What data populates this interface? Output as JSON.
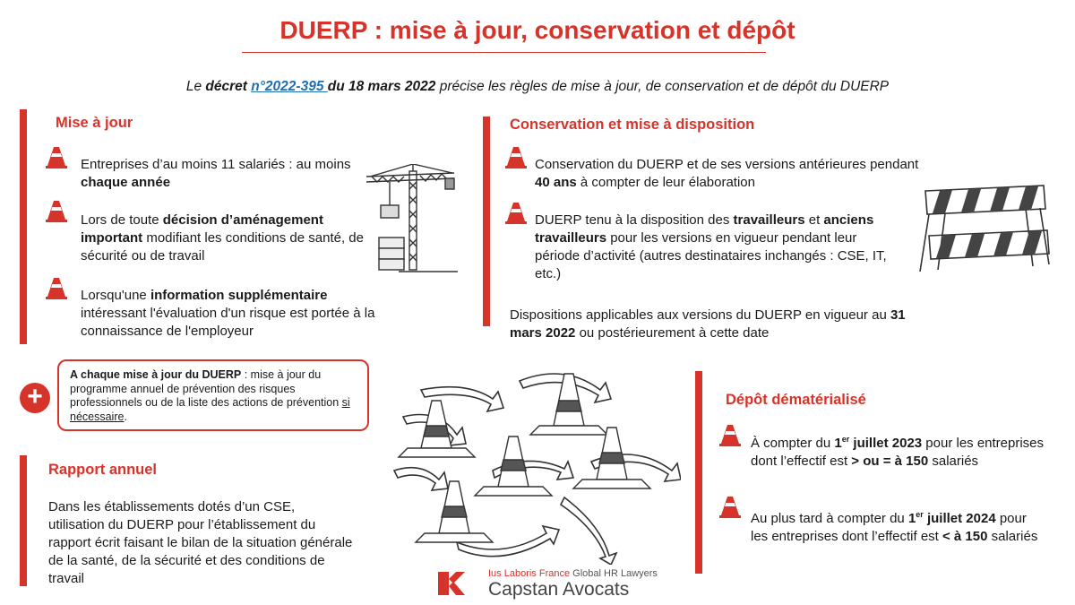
{
  "title": "DUERP : mise à jour, conservation et dépôt",
  "subtitle": {
    "prefix": "Le ",
    "decree_word": "décret ",
    "decree_link": "n°2022-395 ",
    "date": "du 18 mars 2022",
    "suffix": " précise les règles  de mise à jour, de conservation et de dépôt du DUERP"
  },
  "mise_a_jour": {
    "title": "Mise à jour",
    "items": [
      {
        "t1": "Entreprises d’au moins 11 salariés : au moins ",
        "b1": "chaque année"
      },
      {
        "t1": "Lors de toute ",
        "b1": "décision d’aménagement important",
        "t2": " modifiant les conditions de santé, de sécurité ou de travail"
      },
      {
        "t1": "Lorsqu'une ",
        "b1": "information supplémentaire",
        "t2": " intéressant l'évaluation d'un risque est portée à la connaissance de l'employeur"
      }
    ]
  },
  "callout": {
    "bold": "A chaque mise à jour du DUERP",
    "text": " : mise à jour du programme annuel de prévention des risques professionnels ou de la liste des actions de prévention ",
    "underlined": "si nécessaire",
    "end": ".",
    "plus": "+"
  },
  "rapport": {
    "title": "Rapport annuel",
    "text": "Dans les établissements dotés d’un CSE, utilisation du DUERP pour l’établissement du rapport écrit faisant le bilan de la situation générale de la santé, de la sécurité et des conditions de travail"
  },
  "conservation": {
    "title": "Conservation et mise à disposition",
    "item1": {
      "t1": "Conservation du DUERP et de ses versions antérieures pendant ",
      "b1": "40 ans",
      "t2": " à compter de leur élaboration"
    },
    "item2": {
      "t1": "DUERP tenu à la disposition des ",
      "b1": "travailleurs",
      "t2": " et ",
      "b2": "anciens travailleurs",
      "t3": " pour les versions en vigueur pendant leur période d’activité (autres destinataires inchangés : CSE, IT, etc.)"
    },
    "dispositions": {
      "t1": "Dispositions applicables aux versions du DUERP en vigueur au ",
      "b1": "31 mars 2022",
      "t2": " ou postérieurement à cette date"
    }
  },
  "depot": {
    "title": "Dépôt dématérialisé",
    "item1": {
      "t1": "À compter du ",
      "b1": "1",
      "sup": "er",
      "b2": " juillet 2023",
      "t2": " pour les entreprises dont l’effectif est ",
      "b3": "> ou = à 150",
      "t3": " salariés"
    },
    "item2": {
      "t1": "Au plus tard à compter du ",
      "b1": "1",
      "sup": "er",
      "b2": " juillet 2024",
      "t2": " pour les entreprises dont l’effectif est ",
      "b3": "< à 150",
      "t3": " salariés"
    }
  },
  "logo": {
    "line1_red": "Ius Laboris France",
    "line1_rest": " Global HR Lawyers",
    "line2": "Capstan Avocats"
  },
  "colors": {
    "accent": "#d6332a",
    "link": "#1f6fb2"
  },
  "icons": [
    "traffic-cone-icon",
    "plus-icon",
    "crane-illustration",
    "barrier-illustration",
    "cones-arrows-illustration",
    "capstan-logo-icon"
  ]
}
